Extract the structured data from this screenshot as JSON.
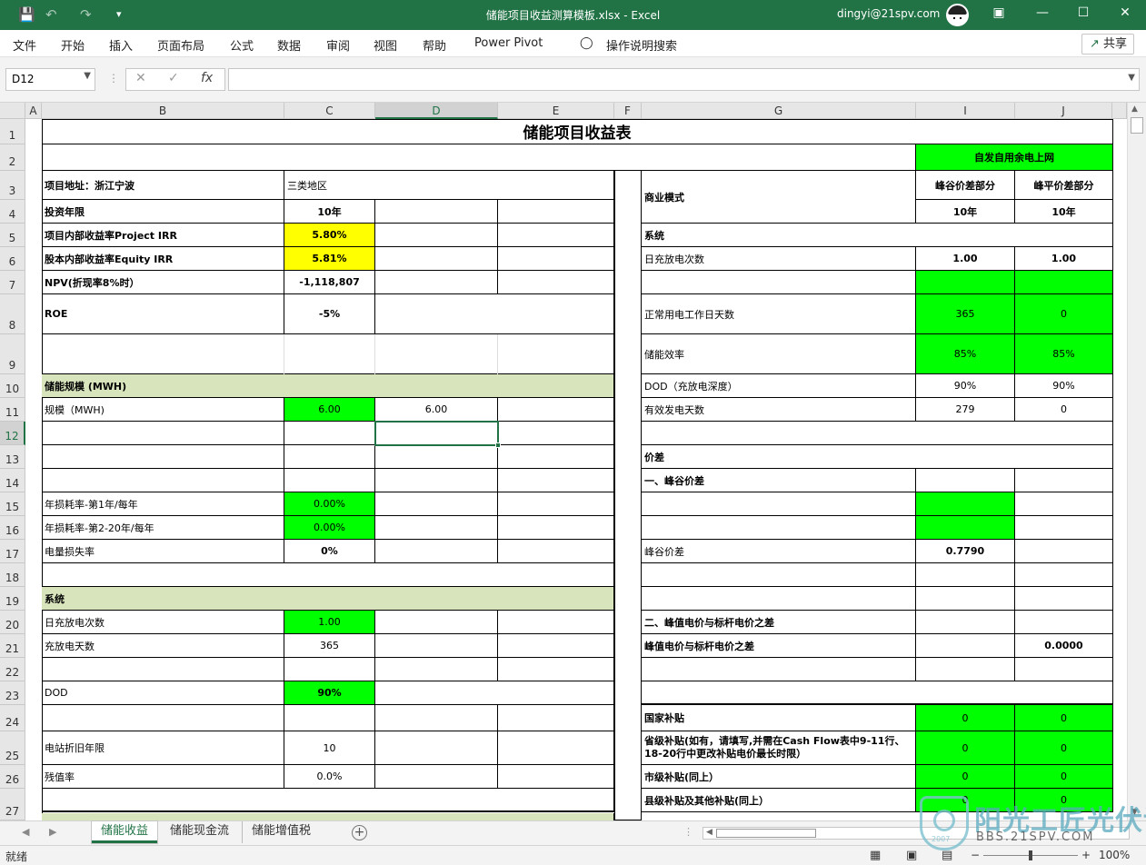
{
  "window": {
    "title": "储能项目收益测算模板.xlsx  -  Excel",
    "user": "dingyi@21spv.com",
    "share_label": "共享",
    "share_icon": "share-icon"
  },
  "menu": [
    "文件",
    "开始",
    "插入",
    "页面布局",
    "公式",
    "数据",
    "审阅",
    "视图",
    "帮助",
    "Power Pivot",
    "操作说明搜索"
  ],
  "formula_bar": {
    "name_box": "D12",
    "formula": ""
  },
  "columns": [
    "A",
    "B",
    "C",
    "D",
    "E",
    "F",
    "G",
    "I",
    "J"
  ],
  "selected_column": "D",
  "rows": [
    "1",
    "2",
    "3",
    "4",
    "5",
    "6",
    "7",
    "8",
    "9",
    "10",
    "11",
    "12",
    "13",
    "14",
    "15",
    "16",
    "17",
    "18",
    "19",
    "20",
    "21",
    "22",
    "23",
    "24",
    "25",
    "26",
    "27"
  ],
  "selected_row": "12",
  "cells": {
    "title": "储能项目收益表",
    "mode_header": "自发自用余电上网",
    "b3": "项目地址：浙江宁波",
    "c3": "三类地区",
    "b4": "投资年限",
    "c4": "10年",
    "b5": "项目内部收益率Project IRR",
    "c5": "5.80%",
    "b6": "股本内部收益率Equity IRR",
    "c6": "5.81%",
    "b7": "NPV(折现率8%时）",
    "c7": "-1,118,807",
    "b8": "ROE",
    "c8": "-5%",
    "b10": "储能规模 (MWH)",
    "b11": "规模（MWH)",
    "c11": "6.00",
    "d11": "6.00",
    "b15": "年损耗率-第1年/每年",
    "c15": "0.00%",
    "b16": "年损耗率-第2-20年/每年",
    "c16": "0.00%",
    "b17": "电量损失率",
    "c17": "0%",
    "b19": "系统",
    "b20": "日充放电次数",
    "c20": "1.00",
    "b21": "充放电天数",
    "c21": "365",
    "b23": "DOD",
    "c23": "90%",
    "b25": "电站折旧年限",
    "c25": "10",
    "b26": "残值率",
    "c26": "0.0%",
    "g3": "商业模式",
    "i3": "峰谷价差部分",
    "j3": "峰平价差部分",
    "i4": "10年",
    "j4": "10年",
    "g5": "系统",
    "g6": "日充放电次数",
    "i6": "1.00",
    "j6": "1.00",
    "g8": "正常用电工作日天数",
    "i8": "365",
    "j8": "0",
    "g9": "储能效率",
    "i9": "85%",
    "j9": "85%",
    "g10": "DOD（充放电深度）",
    "i10": "90%",
    "j10": "90%",
    "g11": "有效发电天数",
    "i11": "279",
    "j11": "0",
    "g13": "价差",
    "g14": "一、峰谷价差",
    "g17": "峰谷价差",
    "i17": "0.7790",
    "g20": "二、峰值电价与标杆电价之差",
    "g21": "峰值电价与标杆电价之差",
    "j21": "0.0000",
    "g24": "国家补贴",
    "i24": "0",
    "j24": "0",
    "g25": "省级补贴(如有，请填写,并需在Cash Flow表中9-11行、18-20行中更改补贴电价最长时限）",
    "i25": "0",
    "j25": "0",
    "g26": "市级补贴(同上）",
    "i26": "0",
    "j26": "0",
    "g27": "县级补贴及其他补贴(同上）",
    "i27": "0",
    "j27": "0"
  },
  "sheet_tabs": [
    "储能收益",
    "储能现金流",
    "储能增值税"
  ],
  "active_tab": "储能收益",
  "status": {
    "ready": "就绪",
    "zoom": "100%"
  },
  "watermark": {
    "title": "阳光工匠光伏论坛",
    "url": "BBS.21SPV.COM",
    "year": "2007"
  },
  "colors": {
    "excel_green": "#217346",
    "cell_green": "#00ff00",
    "cell_yellow": "#ffff00",
    "section_tan": "#d8e4bc"
  }
}
